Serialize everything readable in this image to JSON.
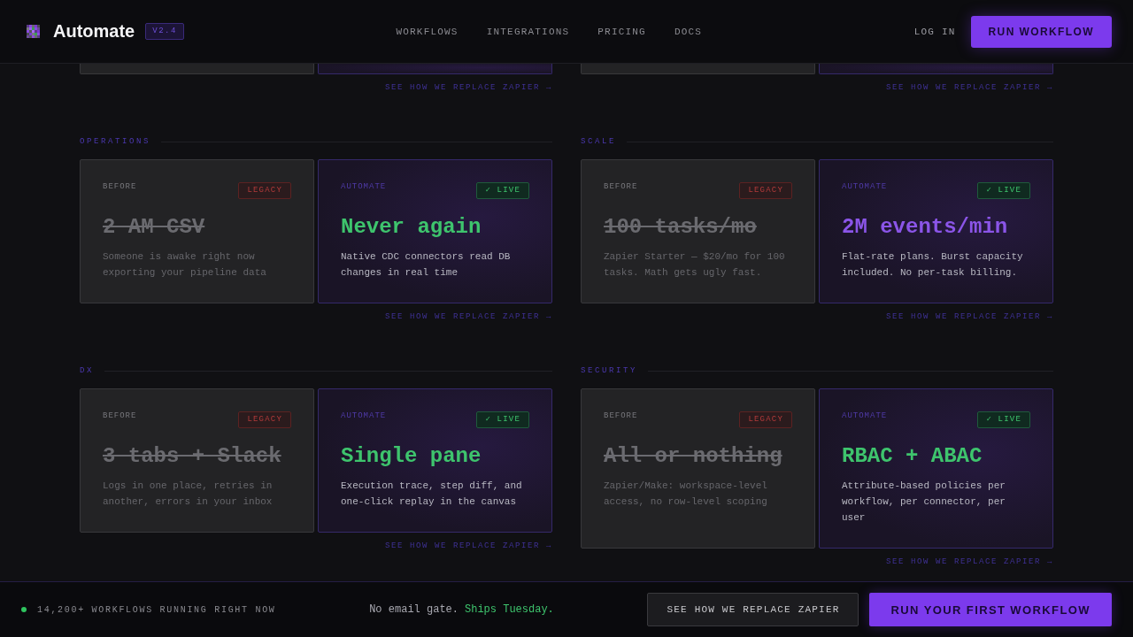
{
  "header": {
    "brand": "Automate",
    "version": "V2.4",
    "nav": [
      "WORKFLOWS",
      "INTEGRATIONS",
      "PRICING",
      "DOCS"
    ],
    "login": "LOG IN",
    "cta": "RUN WORKFLOW"
  },
  "rows": [
    {
      "sections": [
        {
          "cards": [
            {
              "kind": "before"
            },
            {
              "kind": "automate"
            }
          ],
          "link": "SEE HOW WE REPLACE ZAPIER →"
        },
        {
          "cards": [
            {
              "kind": "before"
            },
            {
              "kind": "automate"
            }
          ],
          "link": "SEE HOW WE REPLACE ZAPIER →"
        }
      ]
    },
    {
      "sections": [
        {
          "label": "OPERATIONS",
          "cards": [
            {
              "kind": "before",
              "tag": "BEFORE",
              "badge": "LEGACY",
              "title": "2 AM CSV",
              "text": "Someone is awake right now exporting your pipeline data"
            },
            {
              "kind": "automate",
              "tag": "AUTOMATE",
              "badge": "✓ LIVE",
              "title": "Never again",
              "color": "#3ec46d",
              "text": "Native CDC connectors read DB changes in real time"
            }
          ],
          "link": "SEE HOW WE REPLACE ZAPIER →"
        },
        {
          "label": "SCALE",
          "cards": [
            {
              "kind": "before",
              "tag": "BEFORE",
              "badge": "LEGACY",
              "title": "100 tasks/mo",
              "text": "Zapier Starter — $20/mo for 100 tasks. Math gets ugly fast."
            },
            {
              "kind": "automate",
              "tag": "AUTOMATE",
              "badge": "✓ LIVE",
              "title": "2M events/min",
              "color": "#8b55e8",
              "text": "Flat-rate plans. Burst capacity included. No per-task billing."
            }
          ],
          "link": "SEE HOW WE REPLACE ZAPIER →"
        }
      ]
    },
    {
      "sections": [
        {
          "label": "DX",
          "cards": [
            {
              "kind": "before",
              "tag": "BEFORE",
              "badge": "LEGACY",
              "title": "3 tabs + Slack",
              "text": "Logs in one place, retries in another, errors in your inbox"
            },
            {
              "kind": "automate",
              "tag": "AUTOMATE",
              "badge": "✓ LIVE",
              "title": "Single pane",
              "color": "#3ec46d",
              "text": "Execution trace, step diff, and one-click replay in the canvas"
            }
          ],
          "link": "SEE HOW WE REPLACE ZAPIER →"
        },
        {
          "label": "SECURITY",
          "cards": [
            {
              "kind": "before",
              "tag": "BEFORE",
              "badge": "LEGACY",
              "title": "All or nothing",
              "text": "Zapier/Make: workspace-level access, no row-level scoping"
            },
            {
              "kind": "automate",
              "tag": "AUTOMATE",
              "badge": "✓ LIVE",
              "title": "RBAC + ABAC",
              "color": "#3ec46d",
              "text": "Attribute-based policies per workflow, per connector, per user"
            }
          ],
          "link": "SEE HOW WE REPLACE ZAPIER →"
        }
      ]
    }
  ],
  "footer": {
    "status": "14,200+ WORKFLOWS RUNNING RIGHT NOW",
    "note": "No email gate.",
    "highlight": "Ships Tuesday.",
    "buttons": [
      {
        "kind": "secondary",
        "label": "SEE HOW WE REPLACE ZAPIER"
      },
      {
        "kind": "primary",
        "label": "RUN YOUR FIRST WORKFLOW"
      }
    ]
  }
}
